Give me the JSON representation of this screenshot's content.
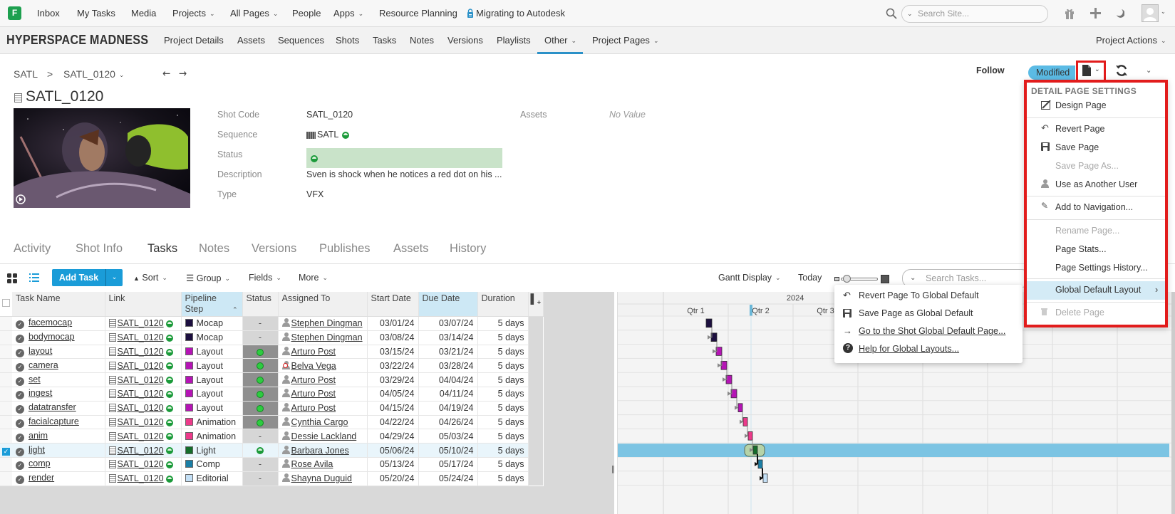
{
  "topnav": {
    "logo": "F",
    "items": [
      "Inbox",
      "My Tasks",
      "Media",
      "Projects",
      "All Pages",
      "People",
      "Apps",
      "Resource Planning",
      "Migrating to Autodesk"
    ],
    "search_placeholder": "Search Site...",
    "icons": [
      "search-icon",
      "gift-icon",
      "plus-icon",
      "moon-icon",
      "avatar"
    ]
  },
  "projnav": {
    "project_title": "HYPERSPACE MADNESS",
    "items": [
      "Project Details",
      "Assets",
      "Sequences",
      "Shots",
      "Tasks",
      "Notes",
      "Versions",
      "Playlists",
      "Other",
      "Project Pages"
    ],
    "active": "Other",
    "actions": "Project Actions"
  },
  "breadcrumb": {
    "parent": "SATL",
    "separator": ">",
    "current": "SATL_0120"
  },
  "entity": {
    "title": "SATL_0120",
    "fields": [
      {
        "label": "Shot Code",
        "value": "SATL_0120"
      },
      {
        "label": "Sequence",
        "value": "SATL"
      },
      {
        "label": "Status",
        "value": ""
      },
      {
        "label": "Description",
        "value": "Sven is shock when he notices a red dot on his ..."
      },
      {
        "label": "Type",
        "value": "VFX"
      }
    ],
    "assets_label": "Assets",
    "assets_value": "No Value"
  },
  "header_actions": {
    "follow": "Follow",
    "modified": "Modified"
  },
  "detail_tabs": [
    "Activity",
    "Shot Info",
    "Tasks",
    "Notes",
    "Versions",
    "Publishes",
    "Assets",
    "History"
  ],
  "active_tab": "Tasks",
  "toolbar": {
    "add_task": "Add Task",
    "sort": "Sort",
    "group": "Group",
    "fields": "Fields",
    "more": "More",
    "gantt_display": "Gantt Display",
    "today": "Today",
    "search_placeholder": "Search Tasks..."
  },
  "table": {
    "columns": [
      "Task Name",
      "Link",
      "Pipeline Step",
      "Status",
      "Assigned To",
      "Start Date",
      "Due Date",
      "Duration"
    ],
    "rows": [
      {
        "task": "facemocap",
        "link": "SATL_0120",
        "step": "Mocap",
        "step_color": "#1c0f3f",
        "status": "-",
        "assignee": "Stephen Dingman",
        "start": "03/01/24",
        "due": "03/07/24",
        "duration": "5 days"
      },
      {
        "task": "bodymocap",
        "link": "SATL_0120",
        "step": "Mocap",
        "step_color": "#1c0f3f",
        "status": "-",
        "assignee": "Stephen Dingman",
        "start": "03/08/24",
        "due": "03/14/24",
        "duration": "5 days"
      },
      {
        "task": "layout",
        "link": "SATL_0120",
        "step": "Layout",
        "step_color": "#b514b5",
        "status": "ip",
        "assignee": "Arturo Post",
        "start": "03/15/24",
        "due": "03/21/24",
        "duration": "5 days"
      },
      {
        "task": "camera",
        "link": "SATL_0120",
        "step": "Layout",
        "step_color": "#b514b5",
        "status": "ip",
        "assignee": "Belva Vega",
        "assignee_blocked": true,
        "start": "03/22/24",
        "due": "03/28/24",
        "duration": "5 days"
      },
      {
        "task": "set",
        "link": "SATL_0120",
        "step": "Layout",
        "step_color": "#b514b5",
        "status": "ip",
        "assignee": "Arturo Post",
        "start": "03/29/24",
        "due": "04/04/24",
        "duration": "5 days"
      },
      {
        "task": "ingest",
        "link": "SATL_0120",
        "step": "Layout",
        "step_color": "#b514b5",
        "status": "ip",
        "assignee": "Arturo Post",
        "start": "04/05/24",
        "due": "04/11/24",
        "duration": "5 days"
      },
      {
        "task": "datatransfer",
        "link": "SATL_0120",
        "step": "Layout",
        "step_color": "#b514b5",
        "status": "ip",
        "assignee": "Arturo Post",
        "start": "04/15/24",
        "due": "04/19/24",
        "duration": "5 days"
      },
      {
        "task": "facialcapture",
        "link": "SATL_0120",
        "step": "Animation",
        "step_color": "#ec3a8a",
        "status": "ip",
        "assignee": "Cynthia Cargo",
        "start": "04/22/24",
        "due": "04/26/24",
        "duration": "5 days"
      },
      {
        "task": "anim",
        "link": "SATL_0120",
        "step": "Animation",
        "step_color": "#ec3a8a",
        "status": "-",
        "assignee": "Dessie Lackland",
        "start": "04/29/24",
        "due": "05/03/24",
        "duration": "5 days"
      },
      {
        "task": "light",
        "link": "SATL_0120",
        "step": "Light",
        "step_color": "#156d2a",
        "status": "fin",
        "assignee": "Barbara Jones",
        "start": "05/06/24",
        "due": "05/10/24",
        "duration": "5 days",
        "selected": true
      },
      {
        "task": "comp",
        "link": "SATL_0120",
        "step": "Comp",
        "step_color": "#1b7fa6",
        "status": "-",
        "assignee": "Rose Avila",
        "start": "05/13/24",
        "due": "05/17/24",
        "duration": "5 days"
      },
      {
        "task": "render",
        "link": "SATL_0120",
        "step": "Editorial",
        "step_color": "#c4e0f6",
        "status": "-",
        "assignee": "Shayna Duguid",
        "start": "05/20/24",
        "due": "05/24/24",
        "duration": "5 days"
      }
    ]
  },
  "gantt": {
    "year": "2024",
    "quarters": [
      "Qtr 1",
      "Qtr 2",
      "Qtr 3"
    ]
  },
  "page_menu": {
    "header": "DETAIL PAGE SETTINGS",
    "items": [
      {
        "label": "Design Page",
        "icon": "design-icon",
        "disabled": false
      },
      {
        "label": "Revert Page",
        "icon": "revert-icon",
        "disabled": false
      },
      {
        "label": "Save Page",
        "icon": "save-icon",
        "disabled": false
      },
      {
        "label": "Save Page As...",
        "icon": "",
        "disabled": true
      },
      {
        "label": "Use as Another User",
        "icon": "user-icon",
        "disabled": false
      },
      {
        "label": "Add to Navigation...",
        "icon": "pencil-icon",
        "disabled": false
      },
      {
        "label": "Rename Page...",
        "icon": "",
        "disabled": true
      },
      {
        "label": "Page Stats...",
        "icon": "",
        "disabled": false
      },
      {
        "label": "Page Settings History...",
        "icon": "",
        "disabled": false
      },
      {
        "label": "Global Default Layout",
        "icon": "",
        "disabled": false,
        "submenu": true
      },
      {
        "label": "Delete Page",
        "icon": "trash-icon",
        "disabled": true
      }
    ]
  },
  "sub_menu": {
    "items": [
      {
        "label": "Revert Page To Global Default",
        "icon": "revert-icon"
      },
      {
        "label": "Save Page as Global Default",
        "icon": "save-icon"
      },
      {
        "label": "Go to the Shot Global Default Page...",
        "icon": "arrow-right-icon",
        "link": true
      },
      {
        "label": "Help for Global Layouts...",
        "icon": "help-icon",
        "link": true
      }
    ]
  },
  "colors": {
    "accent": "#1a9cd8",
    "highlight_box": "#e21c1c",
    "modified_badge": "#5bbbe5",
    "status_green": "#c9e3c9"
  }
}
